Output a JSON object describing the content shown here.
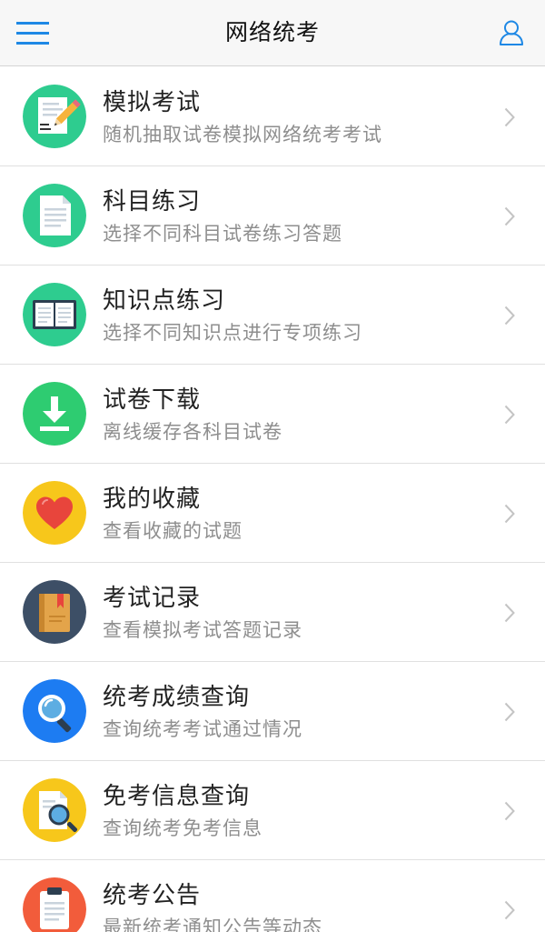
{
  "header": {
    "title": "网络统考",
    "menu_icon": "hamburger-menu-icon",
    "user_icon": "user-profile-icon",
    "accent_color": "#1e88e5"
  },
  "menu": {
    "items": [
      {
        "title": "模拟考试",
        "subtitle": "随机抽取试卷模拟网络统考考试",
        "icon": "exam-paper-pencil-icon",
        "color": "#2ecc8f"
      },
      {
        "title": "科目练习",
        "subtitle": "选择不同科目试卷练习答题",
        "icon": "document-icon",
        "color": "#2ecc8f"
      },
      {
        "title": "知识点练习",
        "subtitle": "选择不同知识点进行专项练习",
        "icon": "open-book-icon",
        "color": "#2ecc8f"
      },
      {
        "title": "试卷下载",
        "subtitle": "离线缓存各科目试卷",
        "icon": "download-icon",
        "color": "#2ecc71"
      },
      {
        "title": "我的收藏",
        "subtitle": "查看收藏的试题",
        "icon": "heart-icon",
        "color": "#f7c71b"
      },
      {
        "title": "考试记录",
        "subtitle": "查看模拟考试答题记录",
        "icon": "record-book-icon",
        "color": "#3d4f66"
      },
      {
        "title": "统考成绩查询",
        "subtitle": "查询统考考试通过情况",
        "icon": "magnifier-icon",
        "color": "#1d7cf2"
      },
      {
        "title": "免考信息查询",
        "subtitle": "查询统考免考信息",
        "icon": "document-search-icon",
        "color": "#f7c71b"
      },
      {
        "title": "统考公告",
        "subtitle": "最新统考通知公告等动态",
        "icon": "clipboard-icon",
        "color": "#f25c3b"
      }
    ],
    "chevron_icon": "chevron-right-icon"
  }
}
